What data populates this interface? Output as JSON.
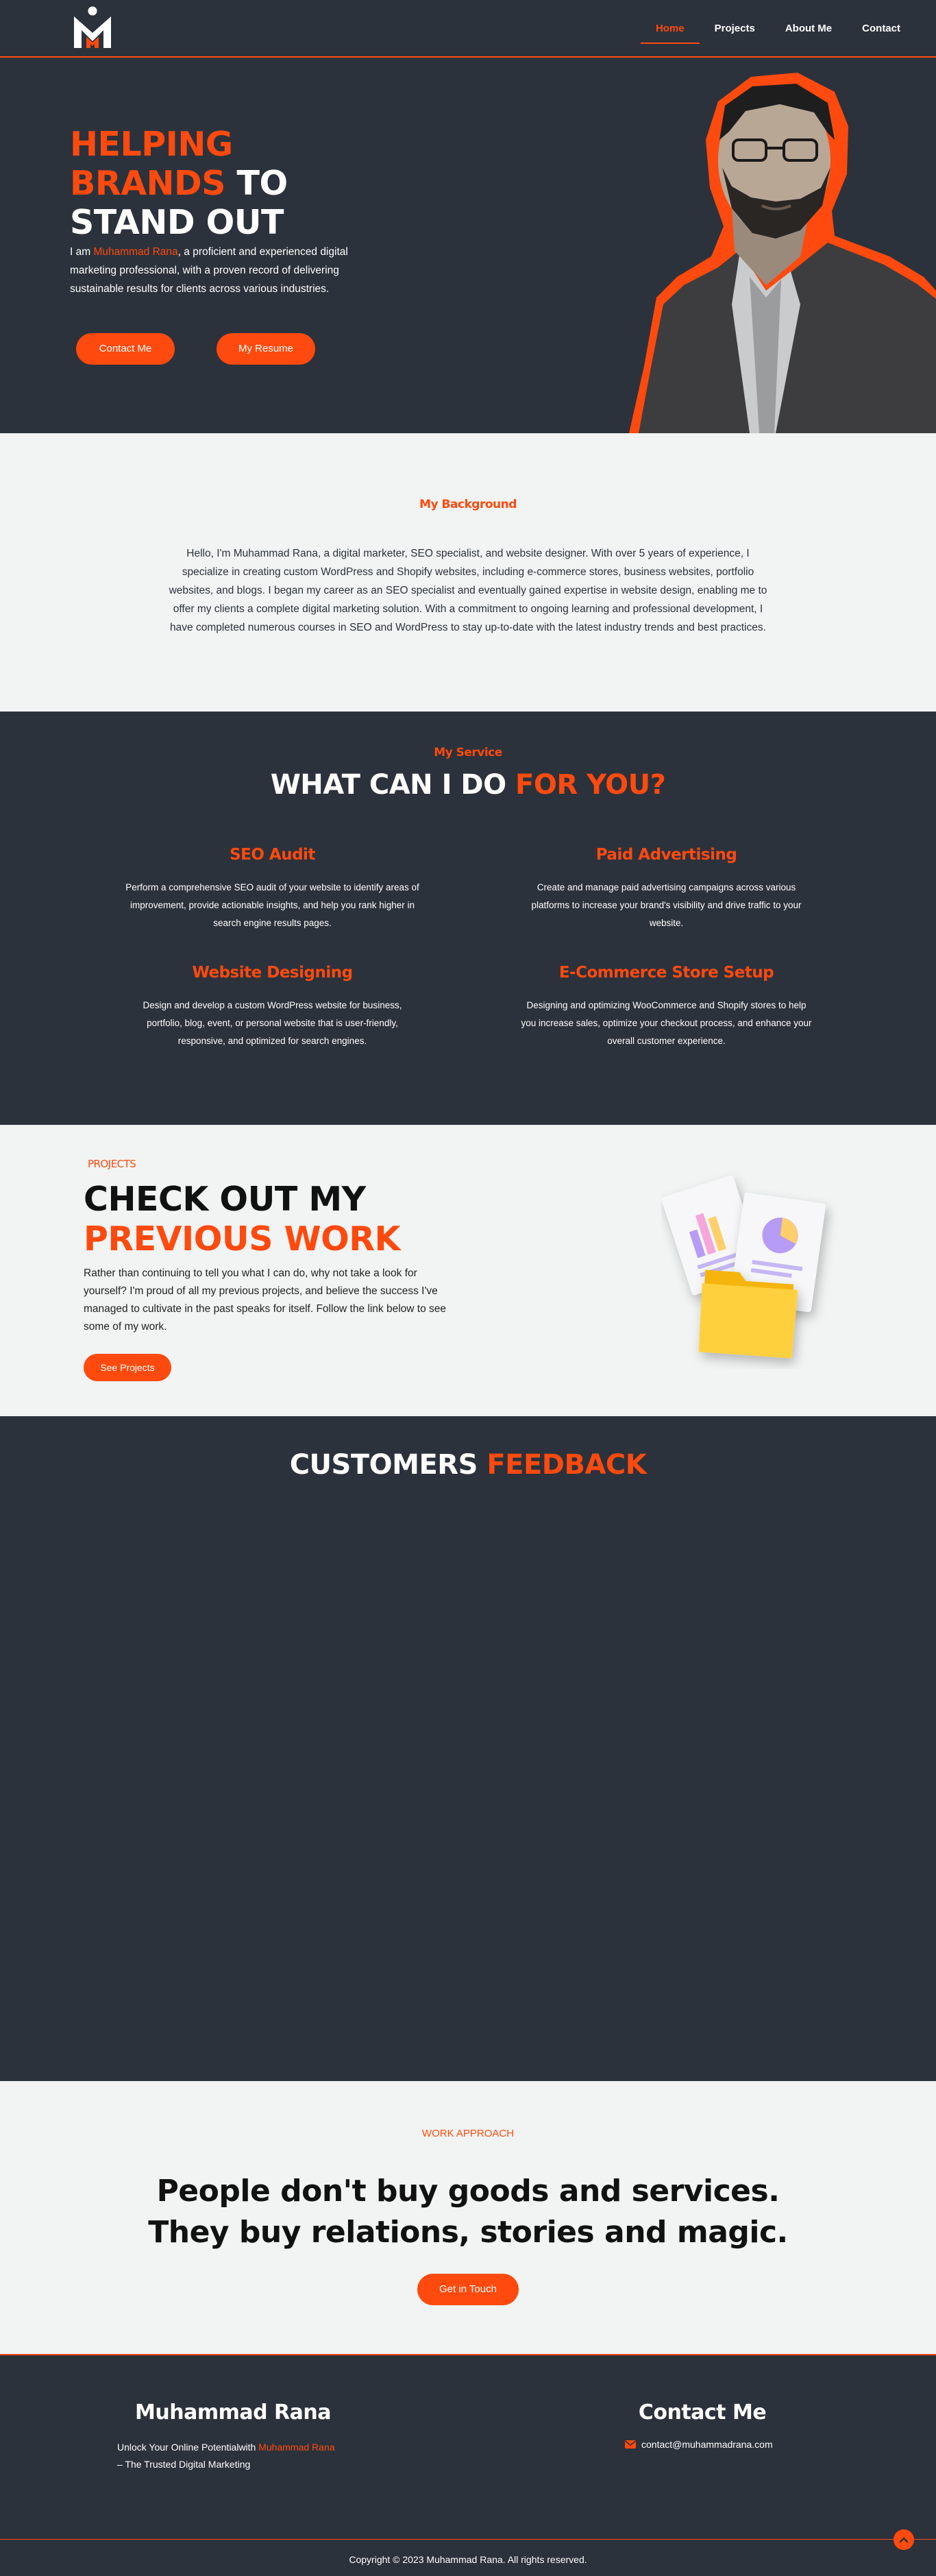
{
  "nav": {
    "links": [
      "Home",
      "Projects",
      "About Me",
      "Contact"
    ],
    "active": "Home"
  },
  "hero": {
    "title_line1": "HELPING",
    "title_line2a": "BRANDS",
    "title_line2b": " TO",
    "title_line3": "STAND OUT",
    "text_prefix": "I am ",
    "text_name": "Muhammad Rana",
    "text_suffix": ", a proficient and experienced digital marketing professional, with a proven record of delivering sustainable results for clients across various industries.",
    "btn_contact": "Contact Me",
    "btn_resume": "My Resume"
  },
  "background": {
    "label": "My Background",
    "text": "Hello, I'm Muhammad Rana, a digital marketer, SEO specialist, and website designer. With over 5 years of experience, I specialize in creating custom WordPress and Shopify websites, including e-commerce stores, business websites, portfolio websites, and blogs. I began my career as an SEO specialist and eventually gained expertise in website design, enabling me to offer my clients a complete digital marketing solution. With a commitment to ongoing learning and professional development, I have completed numerous courses in SEO and WordPress to stay up-to-date with the latest industry trends and best practices."
  },
  "services": {
    "label": "My Service",
    "title_a": "WHAT CAN I DO ",
    "title_b": "FOR YOU?",
    "items": [
      {
        "title": "SEO Audit",
        "text": "Perform a comprehensive SEO audit of your website to identify areas of improvement, provide actionable insights, and help you rank higher in search engine results pages."
      },
      {
        "title": "Paid Advertising",
        "text": "Create and manage paid advertising campaigns across various platforms to increase your brand's visibility and drive traffic to your website."
      },
      {
        "title": "Website Designing",
        "text": "Design and develop a custom WordPress website for business, portfolio, blog, event, or personal website that is user-friendly, responsive, and optimized for search engines."
      },
      {
        "title": "E-Commerce Store Setup",
        "text": "Designing and optimizing WooCommerce and Shopify stores to help you increase sales, optimize your checkout process, and enhance your overall customer experience."
      }
    ]
  },
  "projects": {
    "label": "PROJECTS",
    "title_line1": "CHECK OUT MY",
    "title_line2": "PREVIOUS WORK",
    "text": "Rather than continuing to tell you what I can do, why not take a look for yourself? I'm proud of all my previous projects, and believe the success I've managed to cultivate in the past speaks for itself. Follow the link below to see some of my work.",
    "btn": "See Projects"
  },
  "feedback": {
    "title_a": "CUSTOMERS ",
    "title_b": "FEEDBACK"
  },
  "approach": {
    "label": "WORK APPROACH",
    "line1": "People don't buy goods and services.",
    "line2": "They buy relations, stories and magic.",
    "btn": "Get in Touch"
  },
  "footer": {
    "name": "Muhammad Rana",
    "tag_a": "Unlock Your Online Potentialwith ",
    "tag_name": "Muhammad Rana",
    "tag_b": " – The Trusted Digital Marketing",
    "contact_title": "Contact Me",
    "email": "contact@muhammadrana.com",
    "copyright": "Copyright © 2023 Muhammad Rana. All rights reserved."
  },
  "colors": {
    "accent": "#fe4a0e",
    "dark": "#2c323b",
    "light": "#f1f4f3"
  }
}
